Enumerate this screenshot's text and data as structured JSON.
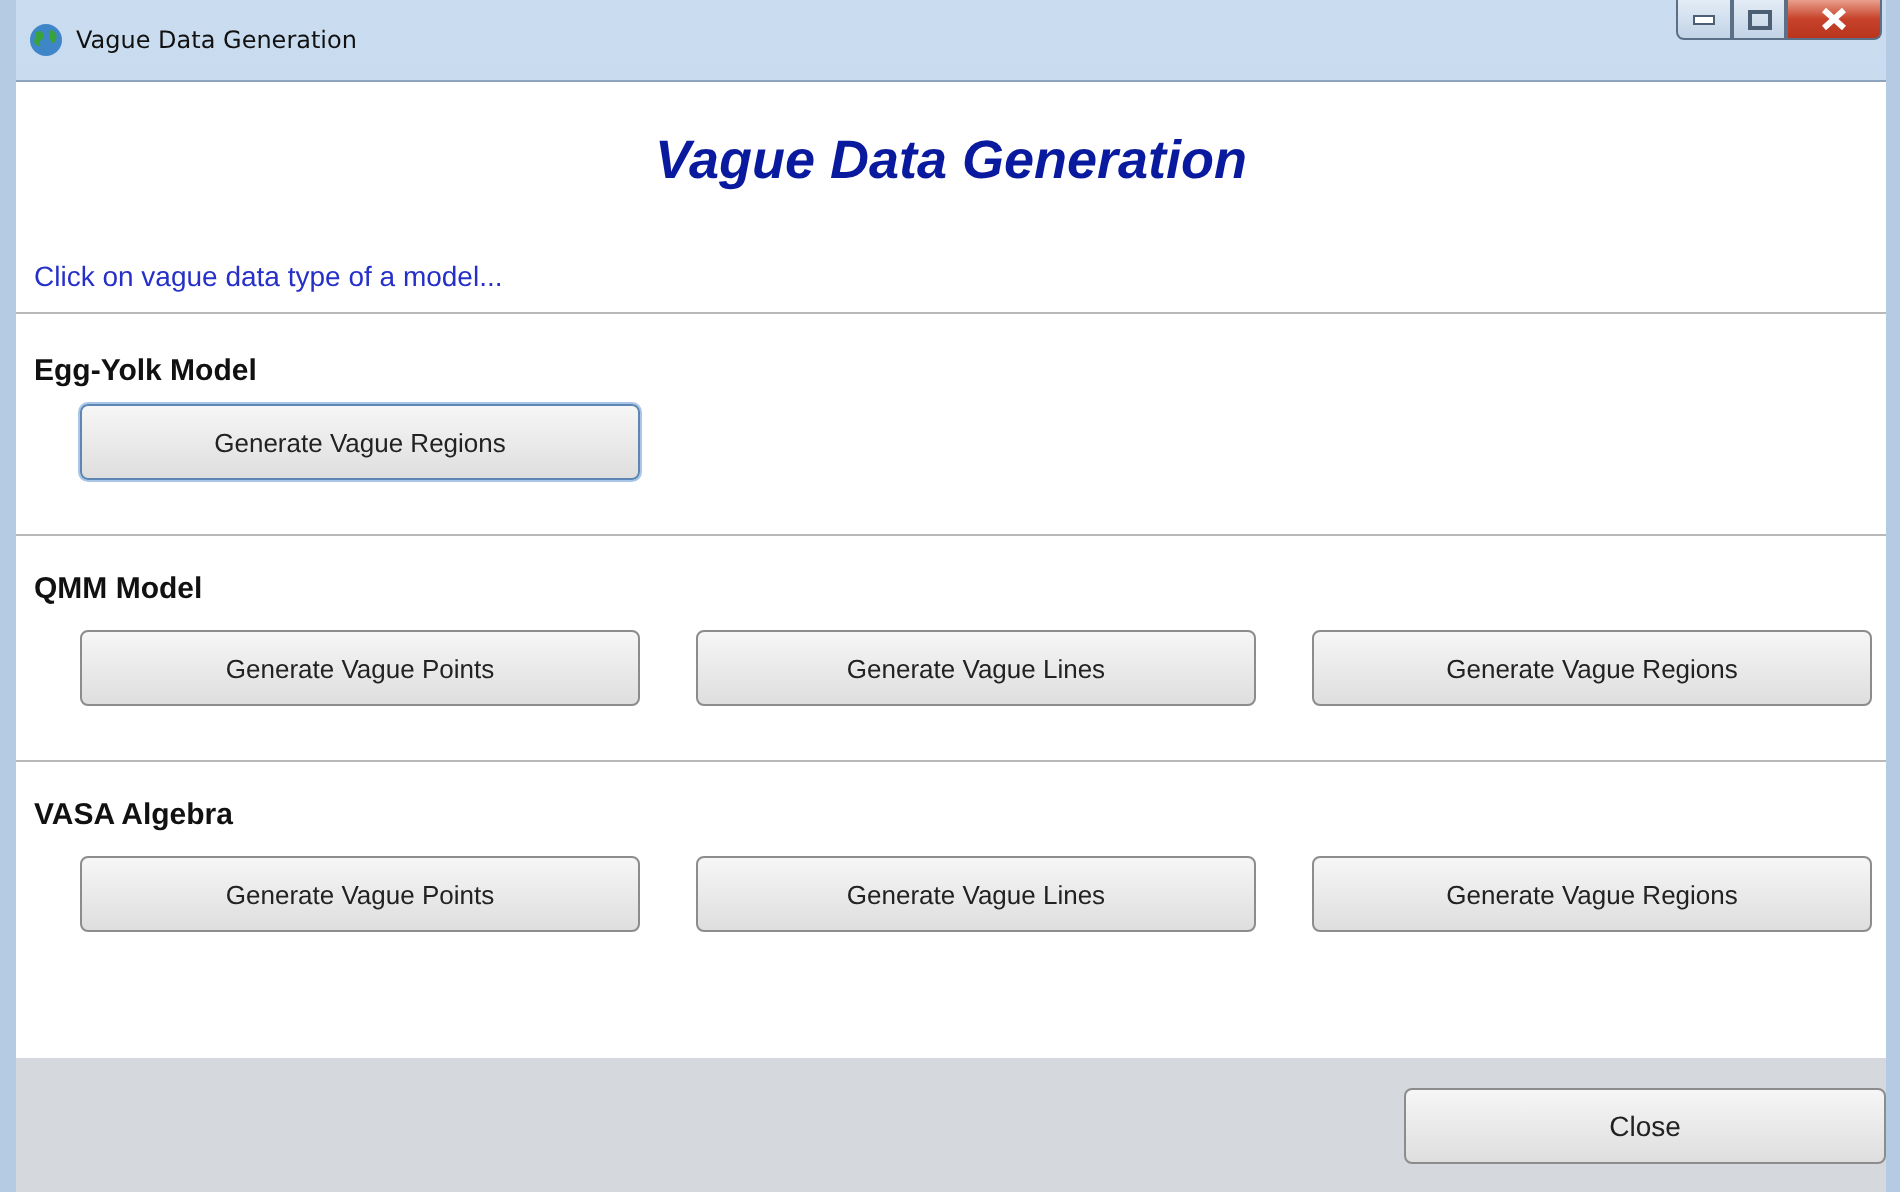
{
  "window": {
    "title": "Vague Data Generation"
  },
  "heading": "Vague Data Generation",
  "instruction": "Click on vague data type of a model...",
  "sections": [
    {
      "title": "Egg-Yolk Model",
      "buttons": [
        {
          "label": "Generate Vague Regions",
          "focused": true
        }
      ]
    },
    {
      "title": "QMM Model",
      "buttons": [
        {
          "label": "Generate Vague Points",
          "focused": false
        },
        {
          "label": "Generate Vague Lines",
          "focused": false
        },
        {
          "label": "Generate Vague Regions",
          "focused": false
        }
      ]
    },
    {
      "title": "VASA Algebra",
      "buttons": [
        {
          "label": "Generate Vague Points",
          "focused": false
        },
        {
          "label": "Generate Vague Lines",
          "focused": false
        },
        {
          "label": "Generate Vague Regions",
          "focused": false
        }
      ]
    }
  ],
  "footer": {
    "buttons": [
      {
        "label": "Close"
      }
    ]
  }
}
